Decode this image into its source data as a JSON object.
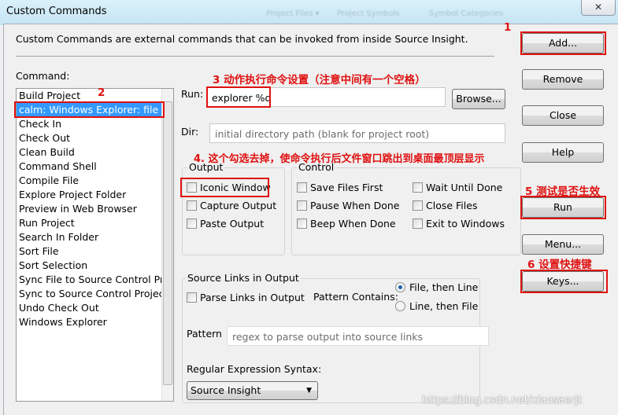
{
  "window": {
    "title": "Custom Commands",
    "close_glyph": "✕",
    "background_tabs": [
      "Project Files ▾",
      "Project Symbols",
      "Symbol Categories"
    ]
  },
  "description": "Custom Commands are external commands that can be invoked from inside Source Insight.",
  "command_label": "Command:",
  "commands": [
    {
      "label": "Build Project",
      "selected": false
    },
    {
      "label": "calm: Windows Explorer: file path",
      "selected": true
    },
    {
      "label": "Check In",
      "selected": false
    },
    {
      "label": "Check Out",
      "selected": false
    },
    {
      "label": "Clean Build",
      "selected": false
    },
    {
      "label": "Command Shell",
      "selected": false
    },
    {
      "label": "Compile File",
      "selected": false
    },
    {
      "label": "Explore Project Folder",
      "selected": false
    },
    {
      "label": "Preview in Web Browser",
      "selected": false
    },
    {
      "label": "Run Project",
      "selected": false
    },
    {
      "label": "Search In Folder",
      "selected": false
    },
    {
      "label": "Sort File",
      "selected": false
    },
    {
      "label": "Sort Selection",
      "selected": false
    },
    {
      "label": "Sync File to Source Control Project",
      "selected": false
    },
    {
      "label": "Sync to Source Control Project",
      "selected": false
    },
    {
      "label": "Undo Check Out",
      "selected": false
    },
    {
      "label": "Windows Explorer",
      "selected": false
    }
  ],
  "run": {
    "label": "Run:",
    "value": "explorer %d",
    "browse": "Browse..."
  },
  "dir": {
    "label": "Dir:",
    "placeholder": "initial directory path (blank for project root)"
  },
  "output": {
    "label": "Output",
    "options": [
      {
        "label": "Iconic Window",
        "checked": false
      },
      {
        "label": "Capture Output",
        "checked": false
      },
      {
        "label": "Paste Output",
        "checked": false
      }
    ]
  },
  "control": {
    "label": "Control",
    "options": [
      {
        "label": "Save Files First",
        "checked": false
      },
      {
        "label": "Wait Until Done",
        "checked": false
      },
      {
        "label": "Pause When Done",
        "checked": false
      },
      {
        "label": "Close Files",
        "checked": false
      },
      {
        "label": "Beep When Done",
        "checked": false
      },
      {
        "label": "Exit to Windows",
        "checked": false
      }
    ]
  },
  "source_links": {
    "label": "Source Links in Output",
    "parse": "Parse Links in Output",
    "pattern_contains": "Pattern Contains:",
    "radio": [
      {
        "label": "File, then Line",
        "selected": true
      },
      {
        "label": "Line, then File",
        "selected": false
      }
    ],
    "pattern_label": "Pattern",
    "pattern_placeholder": "regex to parse output into source links",
    "syntax_label": "Regular Expression Syntax:",
    "syntax_value": "Source Insight"
  },
  "buttons": {
    "add": "Add...",
    "remove": "Remove",
    "close": "Close",
    "help": "Help",
    "run": "Run",
    "menu": "Menu...",
    "keys": "Keys..."
  },
  "annotations": {
    "n1": "1",
    "n2": "2",
    "n3": "3 动作执行命令设置（注意中间有一个空格）",
    "n4": "4. 这个勾选去掉，使命令执行后文件窗口跳出到桌面最顶层显示",
    "n5": "5 测试是否生效",
    "n6": "6 设置快捷键"
  },
  "watermark": "https://blog.csdn.net/xiaosaerjt",
  "colors": {
    "annotation": "#e01010",
    "selection": "#3399ff"
  }
}
